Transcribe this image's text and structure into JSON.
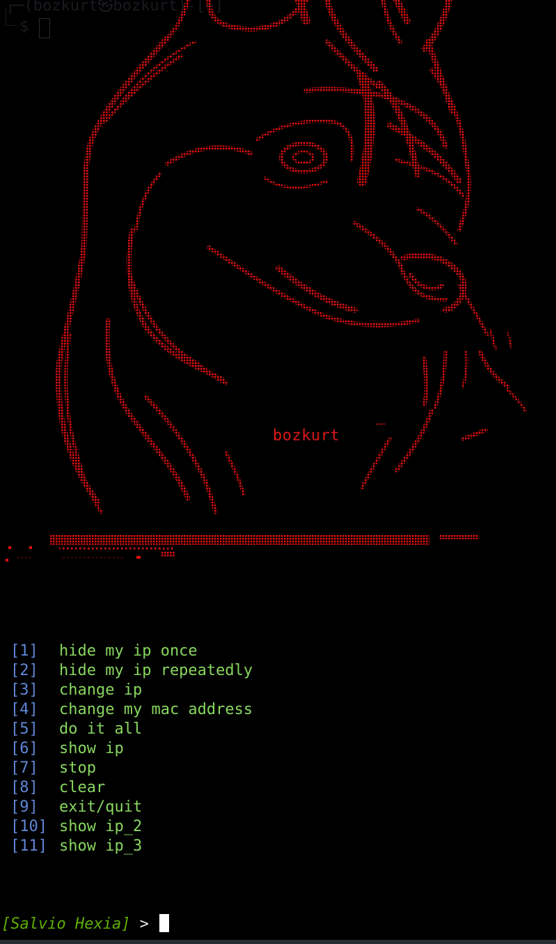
{
  "terminal": {
    "ghost_prompt": "┌─(bozkurt㉿bozkurt)-[~]",
    "ghost_symbol": "$",
    "banner_text": "bozkurt",
    "menu": [
      {
        "key": "[1]",
        "label": "hide my ip once"
      },
      {
        "key": "[2]",
        "label": "hide my ip repeatedly"
      },
      {
        "key": "[3]",
        "label": "change ip"
      },
      {
        "key": "[4]",
        "label": "change my mac address"
      },
      {
        "key": "[5]",
        "label": "do it all"
      },
      {
        "key": "[6]",
        "label": "show ip"
      },
      {
        "key": "[7]",
        "label": "stop"
      },
      {
        "key": "[8]",
        "label": "clear"
      },
      {
        "key": "[9]",
        "label": "exit/quit"
      },
      {
        "key": "[10]",
        "label": "show ip_2"
      },
      {
        "key": "[11]",
        "label": "show ip_3"
      }
    ],
    "prompt_name": "[Salvio Hexia]",
    "prompt_arrow": " > "
  },
  "colors": {
    "background": "#000000",
    "ascii_art": "#e01010",
    "menu_key": "#5f87d7",
    "menu_label": "#87d75f",
    "prompt_name": "#5faf00",
    "cursor": "#ffffff"
  },
  "icons": [
    "cursor-block-icon",
    "wolf-ascii-art"
  ]
}
